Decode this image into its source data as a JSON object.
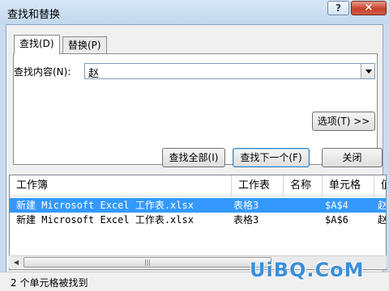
{
  "window": {
    "title": "查找和替换",
    "help_label": "?",
    "close_label": "×"
  },
  "tabs": [
    {
      "label": "查找(D)",
      "active": true
    },
    {
      "label": "替换(P)",
      "active": false
    }
  ],
  "find": {
    "label": "查找内容(N):",
    "value": "赵"
  },
  "buttons": {
    "options": "选项(T) >>",
    "find_all": "查找全部(I)",
    "find_next": "查找下一个(F)",
    "close": "关闭"
  },
  "results": {
    "columns": [
      "工作簿",
      "工作表",
      "名称",
      "单元格",
      "值"
    ],
    "rows": [
      {
        "workbook": "新建 Microsoft Excel 工作表.xlsx",
        "sheet": "表格3",
        "name": "",
        "cell": "$A$4",
        "value": "赵",
        "selected": true
      },
      {
        "workbook": "新建 Microsoft Excel 工作表.xlsx",
        "sheet": "表格3",
        "name": "",
        "cell": "$A$6",
        "value": "赵",
        "selected": false
      }
    ]
  },
  "status": {
    "text": "2 个单元格被找到"
  },
  "watermark": {
    "text": "UiBQ.CoM"
  },
  "colors": {
    "selection": "#3399ff",
    "title_bar": "#c9dcef",
    "close_button": "#c7412b"
  }
}
